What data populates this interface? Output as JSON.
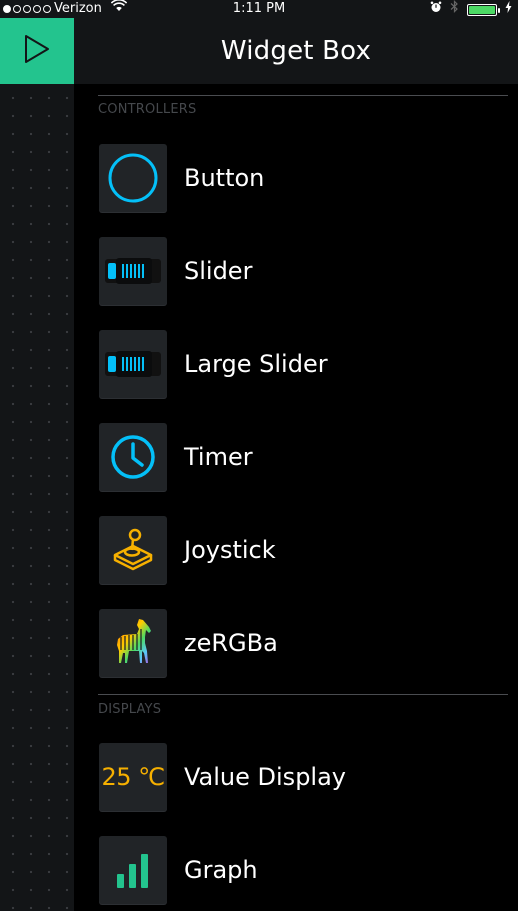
{
  "status_bar": {
    "carrier": "Verizon",
    "time": "1:11 PM",
    "signal_bars_filled": 1,
    "signal_bars_total": 5,
    "battery_level": 1.0,
    "battery_color": "#4cd964"
  },
  "header": {
    "title": "Widget Box"
  },
  "colors": {
    "accent_green": "#23c48e",
    "controller_blue": "#04c0f8",
    "joystick_yellow": "#f6b000",
    "graph_green": "#23c48e"
  },
  "sections": [
    {
      "label": "CONTROLLERS",
      "items": [
        {
          "label": "Button",
          "icon": "button-circle-icon"
        },
        {
          "label": "Slider",
          "icon": "slider-icon"
        },
        {
          "label": "Large Slider",
          "icon": "large-slider-icon"
        },
        {
          "label": "Timer",
          "icon": "timer-clock-icon"
        },
        {
          "label": "Joystick",
          "icon": "joystick-icon"
        },
        {
          "label": "zeRGBa",
          "icon": "zebra-icon"
        }
      ]
    },
    {
      "label": "DISPLAYS",
      "items": [
        {
          "label": "Value Display",
          "icon": "value-display-icon",
          "icon_text": "25 ℃"
        },
        {
          "label": "Graph",
          "icon": "graph-bars-icon"
        }
      ]
    }
  ]
}
